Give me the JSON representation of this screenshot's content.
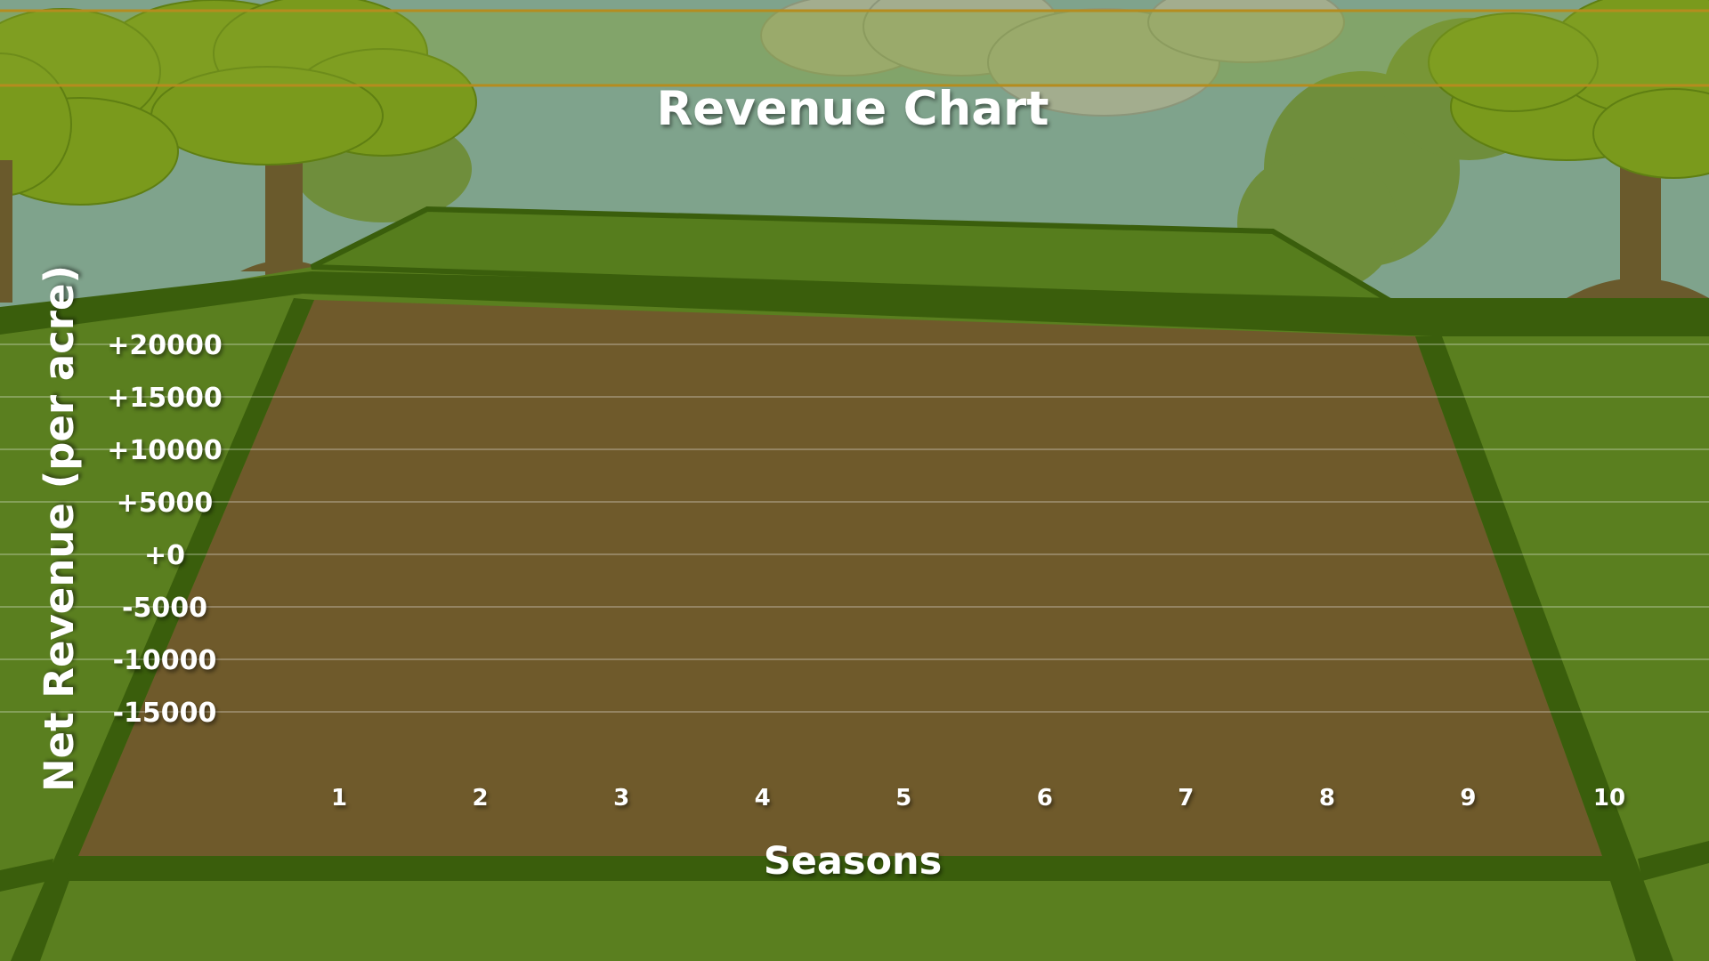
{
  "colors": {
    "sky": "#7fa38c",
    "grass": "#5a7f1f",
    "grass_dark": "#3a5e0c",
    "soil": "#6f5a2b",
    "foliage": "#7a9a1c",
    "trunk": "#6a5a2c",
    "text": "#ffffff"
  },
  "chart_data": {
    "type": "line",
    "title": "Revenue Chart",
    "xlabel": "Seasons",
    "ylabel": "Net Revenue (per acre)",
    "categories": [
      "1",
      "2",
      "3",
      "4",
      "5",
      "6",
      "7",
      "8",
      "9",
      "10"
    ],
    "y_tick_labels": [
      "+20000",
      "+15000",
      "+10000",
      "+5000",
      "+0",
      "-5000",
      "-10000",
      "-15000"
    ],
    "y_ticks": [
      20000,
      15000,
      10000,
      5000,
      0,
      -5000,
      -10000,
      -15000
    ],
    "ylim": [
      -15000,
      20000
    ],
    "grid": true,
    "series": []
  }
}
